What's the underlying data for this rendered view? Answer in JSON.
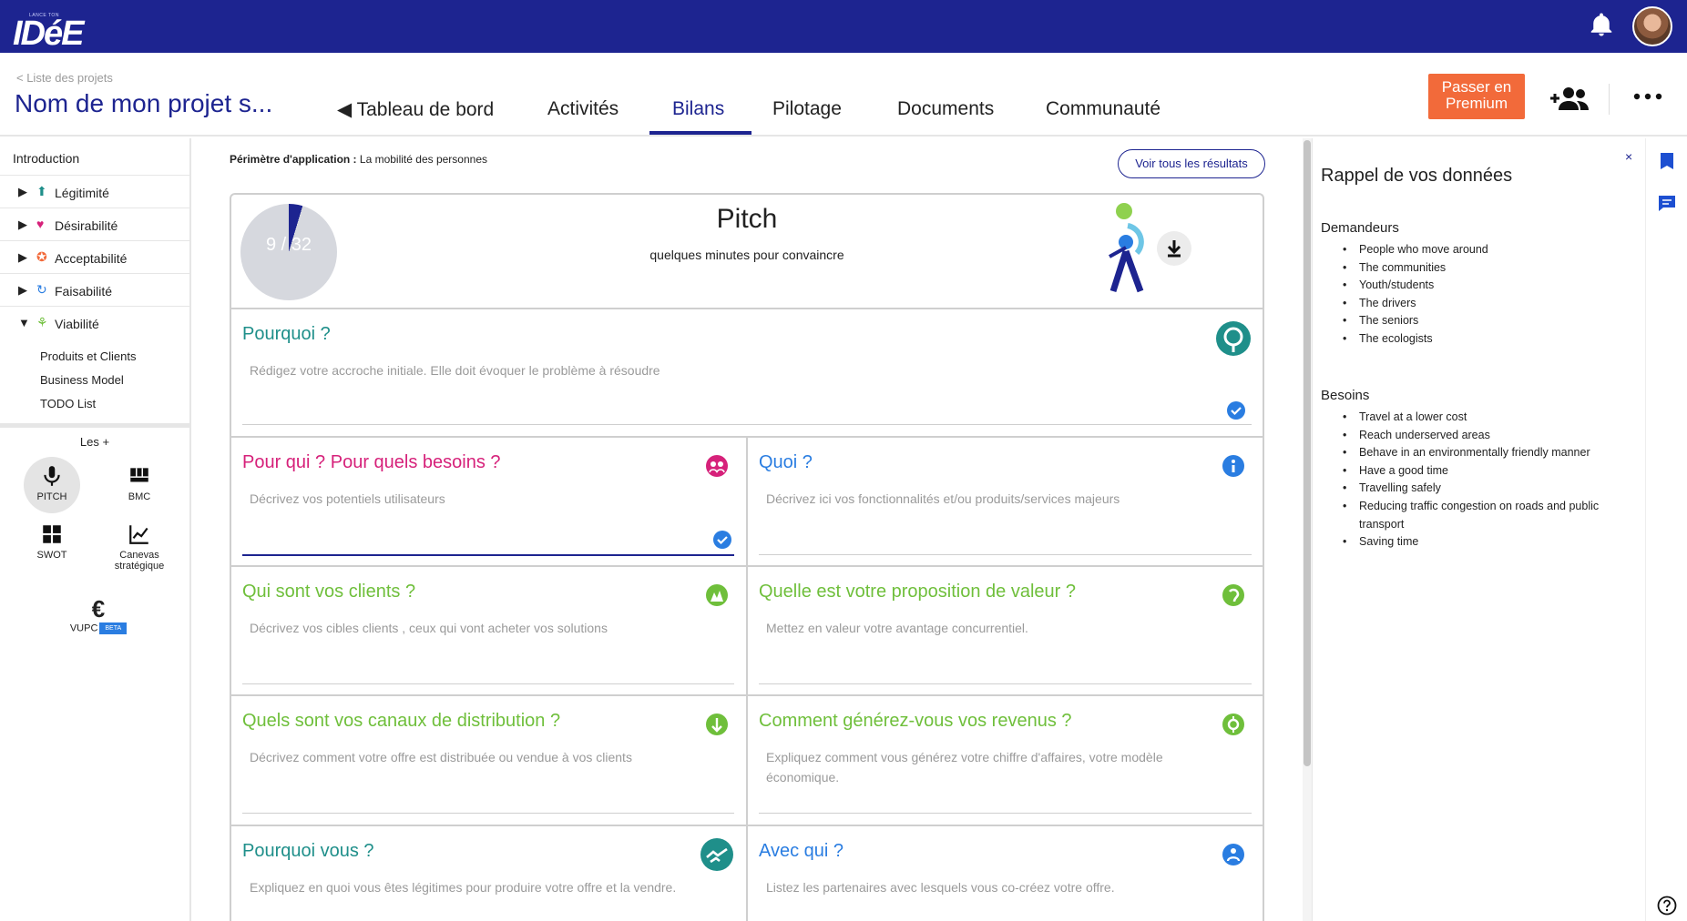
{
  "topbar": {
    "logo_small": "LANCE TON",
    "logo_big": "IDéE",
    "bell_icon": "bell-icon",
    "avatar_icon": "user-avatar"
  },
  "header": {
    "back_link": "< Liste des projets",
    "project_title": "Nom de mon projet s...",
    "tabs": [
      {
        "label": "◀ Tableau de bord"
      },
      {
        "label": "Activités"
      },
      {
        "label": "Bilans"
      },
      {
        "label": "Pilotage"
      },
      {
        "label": "Documents"
      },
      {
        "label": "Communauté"
      }
    ],
    "active_tab": "Bilans",
    "premium_line1": "Passer en",
    "premium_line2": "Premium",
    "add_member_icon": "add-user-icon",
    "more_icon": "more-horizontal-icon"
  },
  "sidebar": {
    "intro": "Introduction",
    "sections": [
      {
        "arrow": "▶",
        "icon": "⬆",
        "label": "Légitimité",
        "color": "#1f8f8a"
      },
      {
        "arrow": "▶",
        "icon": "♥",
        "label": "Désirabilité",
        "color": "#d6217a"
      },
      {
        "arrow": "▶",
        "icon": "✪",
        "label": "Acceptabilité",
        "color": "#f26a3a"
      },
      {
        "arrow": "▶",
        "icon": "↻",
        "label": "Faisabilité",
        "color": "#2a7de1"
      },
      {
        "arrow": "▼",
        "icon": "⚘",
        "label": "Viabilité",
        "color": "#6fbf3b"
      }
    ],
    "sub_items": [
      "Produits et Clients",
      "Business Model",
      "TODO List"
    ],
    "les_plus": "Les +",
    "tools": {
      "pitch": "PITCH",
      "bmc": "BMC",
      "swot": "SWOT",
      "canevas_1": "Canevas",
      "canevas_2": "stratégique",
      "vupc": "VUPC",
      "beta": "BETA",
      "euro": "€"
    }
  },
  "main": {
    "perimetre_label": "Périmètre d'application :",
    "perimetre_value": "La mobilité des personnes",
    "voir_button": "Voir tous les résultats",
    "score": "9 / 32",
    "score_value": 9,
    "score_total": 32,
    "pitch_title": "Pitch",
    "pitch_subtitle": "quelques minutes pour convaincre",
    "download_icon": "download-icon",
    "cells": {
      "pourquoi": {
        "title": "Pourquoi ?",
        "hint": "Rédigez votre accroche initiale. Elle doit évoquer le problème à résoudre",
        "color": "#1f8f8a"
      },
      "pourqui": {
        "title": "Pour qui ? Pour quels besoins ?",
        "hint": "Décrivez vos potentiels utilisateurs",
        "color": "#d6217a"
      },
      "quoi": {
        "title": "Quoi ?",
        "hint": "Décrivez ici vos fonctionnalités et/ou produits/services majeurs",
        "color": "#2a7de1"
      },
      "clients": {
        "title": "Qui sont vos clients ?",
        "hint": "Décrivez vos cibles clients , ceux qui vont acheter vos solutions",
        "color": "#6fbf3b"
      },
      "valeur": {
        "title": "Quelle est votre proposition de valeur ?",
        "hint": "Mettez en valeur votre avantage concurrentiel.",
        "color": "#6fbf3b"
      },
      "canaux": {
        "title": "Quels sont vos canaux de distribution ?",
        "hint": "Décrivez comment votre offre est distribuée ou vendue à vos clients",
        "color": "#6fbf3b"
      },
      "revenus": {
        "title": "Comment générez-vous vos revenus ?",
        "hint_1": "Expliquez comment vous générez votre chiffre d'affaires, votre modèle",
        "hint_2": "économique.",
        "color": "#6fbf3b"
      },
      "pourquoivous": {
        "title": "Pourquoi vous ?",
        "hint": "Expliquez en quoi vous êtes légitimes pour produire votre offre et la vendre.",
        "color": "#1f8f8a"
      },
      "avecqui": {
        "title": "Avec qui ?",
        "hint": "Listez les partenaires avec lesquels vous co-créez votre offre.",
        "color": "#2a7de1"
      }
    }
  },
  "right_panel": {
    "close": "×",
    "title": "Rappel de vos données",
    "demandeurs_title": "Demandeurs",
    "demandeurs": [
      "People who move around",
      "The communities",
      "Youth/students",
      "The drivers",
      "The seniors",
      "The ecologists"
    ],
    "besoins_title": "Besoins",
    "besoins": [
      "Travel at a lower cost",
      "Reach underserved areas",
      "Behave in an environmentally friendly manner",
      "Have a good time",
      "Travelling safely",
      "Reducing traffic congestion on roads and public transport",
      "Saving time"
    ]
  },
  "colors": {
    "brand": "#1d2490",
    "premium": "#f26a3a",
    "teal": "#1f8f8a",
    "magenta": "#d6217a",
    "blue": "#2a7de1",
    "green": "#6fbf3b"
  }
}
